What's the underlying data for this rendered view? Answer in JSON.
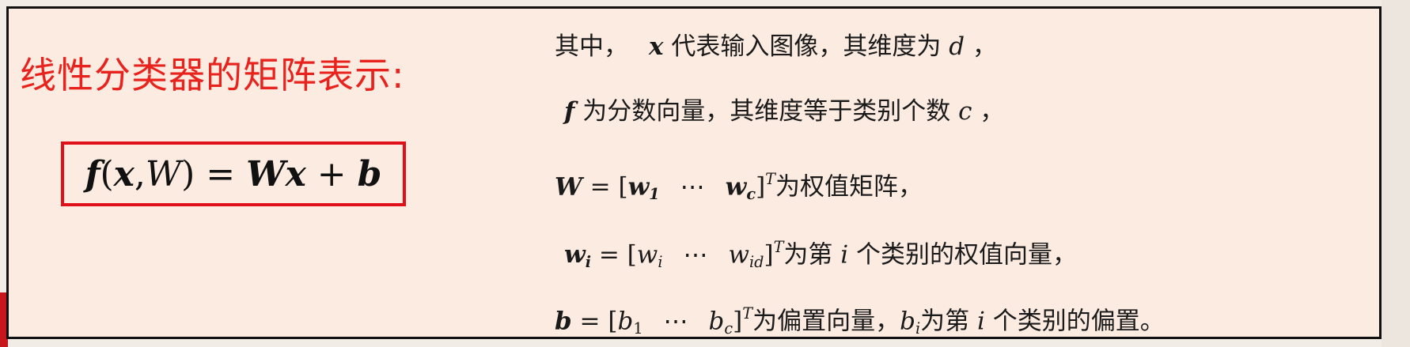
{
  "heading": "线性分类器的矩阵表示:",
  "formula": {
    "f": "f",
    "lparen": "(",
    "x": "x",
    "comma": ",",
    "W": "W",
    "rparen_eq": ") = ",
    "Wx": "Wx",
    "plus": " + ",
    "b": "b"
  },
  "lines": {
    "l1": {
      "t1": "其中，",
      "x": "x",
      "t2": "代表输入图像，其维度为",
      "d": "d",
      "t3": "，"
    },
    "l2": {
      "f": "f",
      "t1": "为分数向量，其维度等于类别个数",
      "c": "c",
      "t2": "，"
    },
    "l3": {
      "W": "W",
      "eq": " = [",
      "w": "w",
      "s1": "1",
      "dots": "⋯",
      "wc": "w",
      "sc": "c",
      "close": "]",
      "T": "T",
      "t1": "为权值矩阵，"
    },
    "l4": {
      "w": "w",
      "si": "i",
      "eq": " = [",
      "wi": "w",
      "s1": "i",
      "dots": "⋯",
      "wid": "w",
      "s2": "id",
      "close": "]",
      "T": "T",
      "t1": "为第",
      "i": "i",
      "t2": "个类别的权值向量，"
    },
    "l5": {
      "b": "b",
      "eq": " = [",
      "b1": "b",
      "s1": "1",
      "dots": "⋯",
      "bc": "b",
      "s2": "c",
      "close": "]",
      "T": "T",
      "t1": "为偏置向量，",
      "bi": "b",
      "s3": "i",
      "t2": "为第",
      "i": "i",
      "t3": "个类别的偏置。"
    }
  },
  "colors": {
    "heading": "#e8231e",
    "box_border": "#e0101b",
    "background": "#fcebe1"
  }
}
